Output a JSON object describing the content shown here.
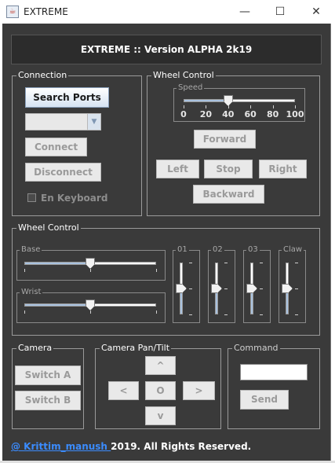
{
  "window": {
    "title": "EXTREME",
    "minimize_glyph": "—",
    "maximize_glyph": "☐",
    "close_glyph": "✕",
    "app_icon": "java-cup-icon"
  },
  "header": {
    "title": "EXTREME :: Version ALPHA 2k19"
  },
  "connection": {
    "label": "Connection",
    "search_ports": "Search Ports",
    "port_value": "",
    "connect": "Connect",
    "disconnect": "Disconnect",
    "en_keyboard": "En Keyboard",
    "en_keyboard_checked": false
  },
  "wheel_control": {
    "label": "Wheel Control",
    "speed_label": "Speed",
    "speed_value": 40,
    "speed_min": 0,
    "speed_max": 100,
    "speed_ticks": [
      "0",
      "20",
      "40",
      "60",
      "80",
      "100"
    ],
    "forward": "Forward",
    "left": "Left",
    "stop": "Stop",
    "right": "Right",
    "backward": "Backward"
  },
  "arm_control": {
    "label": "Wheel Control",
    "base_label": "Base",
    "base_value": 0.5,
    "wrist_label": "Wrist",
    "wrist_value": 0.5,
    "vsliders": [
      {
        "label": "01",
        "value": 0.5
      },
      {
        "label": "02",
        "value": 0.5
      },
      {
        "label": "03",
        "value": 0.5
      },
      {
        "label": "Claw",
        "value": 0.5
      }
    ]
  },
  "camera": {
    "label": "Camera",
    "switch_a": "Switch A",
    "switch_b": "Switch B"
  },
  "pan_tilt": {
    "label": "Camera Pan/Tilt",
    "up": "^",
    "left": "<",
    "center": "O",
    "right": ">",
    "down": "v"
  },
  "command": {
    "label": "Command",
    "value": "",
    "send": "Send"
  },
  "footer": {
    "link": "@ Krittim_manush ",
    "text": "2019. All Rights Reserved."
  },
  "colors": {
    "panel_bg": "#3a3a3a",
    "header_bg": "#2c2c2c",
    "link": "#3b8cff",
    "slider_fill": "#a9c2df"
  }
}
